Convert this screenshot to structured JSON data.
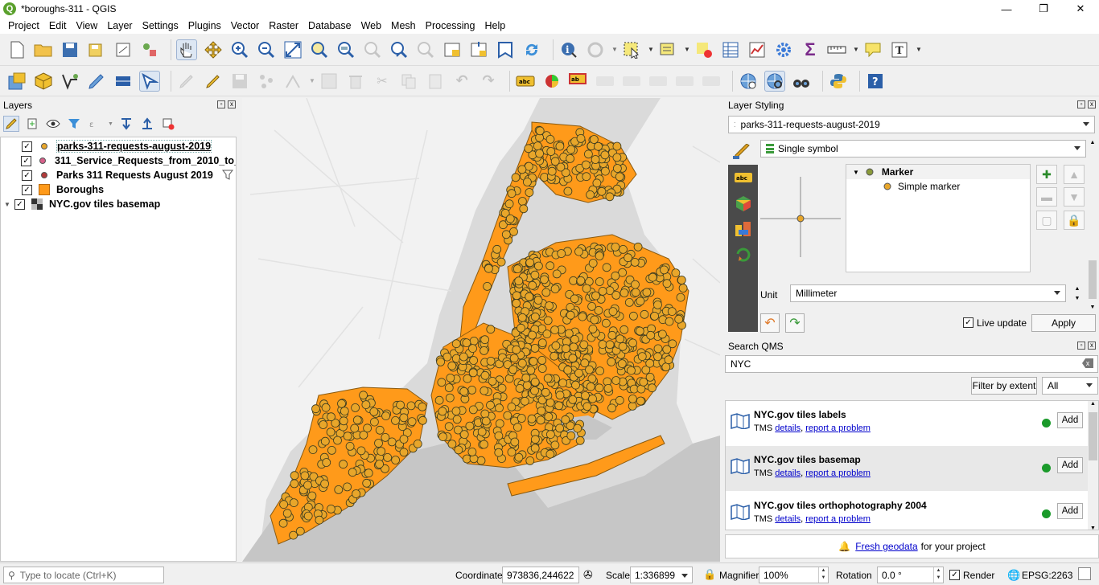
{
  "window": {
    "title": "*boroughs-311 - QGIS",
    "controls": [
      "—",
      "❐",
      "✕"
    ]
  },
  "menubar": [
    "Project",
    "Edit",
    "View",
    "Layer",
    "Settings",
    "Plugins",
    "Vector",
    "Raster",
    "Database",
    "Web",
    "Mesh",
    "Processing",
    "Help"
  ],
  "layers_panel": {
    "title": "Layers",
    "layers": [
      {
        "name": "parks-311-requests-august-2019",
        "checked": true,
        "symbol": "point-orange",
        "selected": true
      },
      {
        "name": "311_Service_Requests_from_2010_to_...",
        "checked": true,
        "symbol": "point-pink"
      },
      {
        "name": "Parks 311 Requests August 2019",
        "checked": true,
        "symbol": "point-red",
        "filtered": true
      },
      {
        "name": "Boroughs",
        "checked": true,
        "symbol": "polygon-orange"
      },
      {
        "name": "NYC.gov tiles basemap",
        "checked": true,
        "symbol": "raster-tiles",
        "expandable": true
      }
    ]
  },
  "layer_styling": {
    "title": "Layer Styling",
    "layer_select": "parks-311-requests-august-2019",
    "renderer": "Single symbol",
    "symbol_tree": {
      "root": "Marker",
      "child": "Simple marker"
    },
    "unit_label": "Unit",
    "unit_value": "Millimeter",
    "live_update_label": "Live update",
    "apply_label": "Apply"
  },
  "search_qms": {
    "title": "Search QMS",
    "query": "NYC",
    "filter_button": "Filter by extent",
    "filter_select": "All",
    "results": [
      {
        "title": "NYC.gov tiles labels",
        "type": "TMS",
        "details": "details",
        "report": "report a problem",
        "add": "Add"
      },
      {
        "title": "NYC.gov tiles basemap",
        "type": "TMS",
        "details": "details",
        "report": "report a problem",
        "add": "Add"
      },
      {
        "title": "NYC.gov tiles orthophotography 2004",
        "type": "TMS",
        "details": "details",
        "report": "report a problem",
        "add": "Add"
      }
    ],
    "footer_link": "Fresh geodata",
    "footer_text": "for your project"
  },
  "statusbar": {
    "locate_placeholder": "Type to locate (Ctrl+K)",
    "coordinate_label": "Coordinate",
    "coordinate_value": "973836,244622",
    "scale_label": "Scale",
    "scale_value": "1:336899",
    "magnifier_label": "Magnifier",
    "magnifier_value": "100%",
    "rotation_label": "Rotation",
    "rotation_value": "0.0 °",
    "render_label": "Render",
    "crs": "EPSG:2263"
  },
  "colors": {
    "accent": "#ff9a1a",
    "point_fill": "#e8a62a",
    "map_bg": "#d7d7d7",
    "water": "#c9c9c9"
  }
}
